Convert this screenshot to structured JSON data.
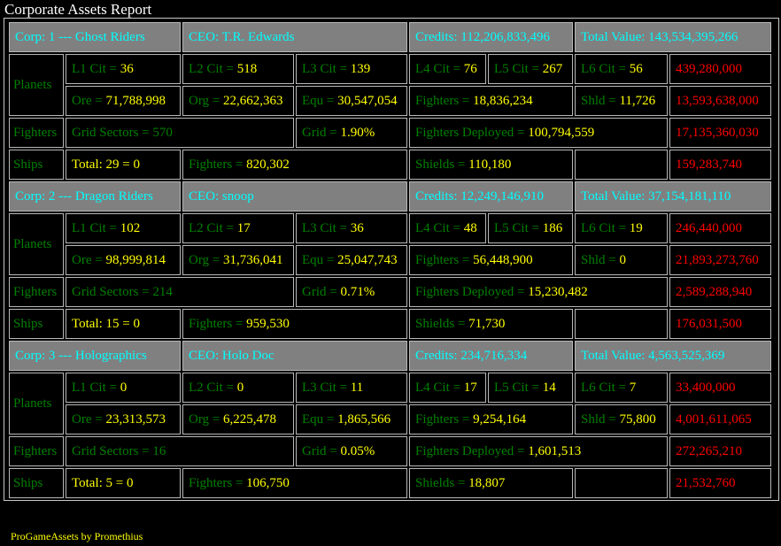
{
  "window": {
    "title": "Corporate Assets Report"
  },
  "labels": {
    "planets": "Planets",
    "fighters": "Fighters",
    "ships": "Ships",
    "l1": "L1 Cit = ",
    "l2": "L2 Cit = ",
    "l3": "L3 Cit = ",
    "l4": "L4 Cit = ",
    "l5": "L5 Cit = ",
    "l6": "L6 Cit = ",
    "ore": "Ore = ",
    "org": "Org = ",
    "equ": "Equ = ",
    "fighters_eq": "Fighters = ",
    "shld": "Shld = ",
    "grid_sectors": "Grid Sectors = ",
    "grid": "Grid = ",
    "fighters_deployed": "Fighters Deployed = ",
    "total": "Total: ",
    "shields": "Shields = ",
    "credits": "Credits:  ",
    "total_value": "Total Value: "
  },
  "corps": [
    {
      "header": "Corp: 1 --- Ghost Riders",
      "ceo": "CEO: T.R. Edwards",
      "credits": "112,206,833,496",
      "total_value": "143,534,395,266",
      "planets": {
        "l1": "36",
        "l2": "518",
        "l3": "139",
        "l4": "76",
        "l5": "267",
        "l6": "56",
        "value1": "439,280,000",
        "ore": "71,788,998",
        "org": "22,662,363",
        "equ": "30,547,054",
        "fighters": "18,836,234",
        "shld": "11,726",
        "value2": "13,593,638,000"
      },
      "fighters": {
        "grid_sectors": "570",
        "grid": "1.90%",
        "deployed": "100,794,559",
        "value": "17,135,360,030"
      },
      "ships": {
        "total": "29 = 0",
        "fighters": "820,302",
        "shields": "110,180",
        "value": "159,283,740"
      }
    },
    {
      "header": "Corp: 2 --- Dragon Riders",
      "ceo": "CEO: snoop",
      "credits": "12,249,146,910",
      "total_value": "37,154,181,110",
      "planets": {
        "l1": "102",
        "l2": "17",
        "l3": "36",
        "l4": "48",
        "l5": "186",
        "l6": "19",
        "value1": "246,440,000",
        "ore": "98,999,814",
        "org": "31,736,041",
        "equ": "25,047,743",
        "fighters": "56,448,900",
        "shld": "0",
        "value2": "21,893,273,760"
      },
      "fighters": {
        "grid_sectors": "214",
        "grid": "0.71%",
        "deployed": "15,230,482",
        "value": "2,589,288,940"
      },
      "ships": {
        "total": "15 = 0",
        "fighters": "959,530",
        "shields": "71,730",
        "value": "176,031,500"
      }
    },
    {
      "header": "Corp: 3 --- Holographics",
      "ceo": "CEO: Holo Doc",
      "credits": "234,716,334",
      "total_value": "4,563,525,369",
      "planets": {
        "l1": "0",
        "l2": "0",
        "l3": "11",
        "l4": "17",
        "l5": "14",
        "l6": "7",
        "value1": "33,400,000",
        "ore": "23,313,573",
        "org": "6,225,478",
        "equ": "1,865,566",
        "fighters": "9,254,164",
        "shld": "75,800",
        "value2": "4,001,611,065"
      },
      "fighters": {
        "grid_sectors": "16",
        "grid": "0.05%",
        "deployed": "1,601,513",
        "value": "272,265,210"
      },
      "ships": {
        "total": "5 = 0",
        "fighters": "106,750",
        "shields": "18,807",
        "value": "21,532,760"
      }
    }
  ],
  "footer": {
    "text": "ProGameAssets by Promethius"
  },
  "colors": {
    "header_bg": "#808080",
    "header_text": "#00ffff",
    "label": "#008000",
    "value": "#ffff00",
    "money": "#ff0000"
  }
}
